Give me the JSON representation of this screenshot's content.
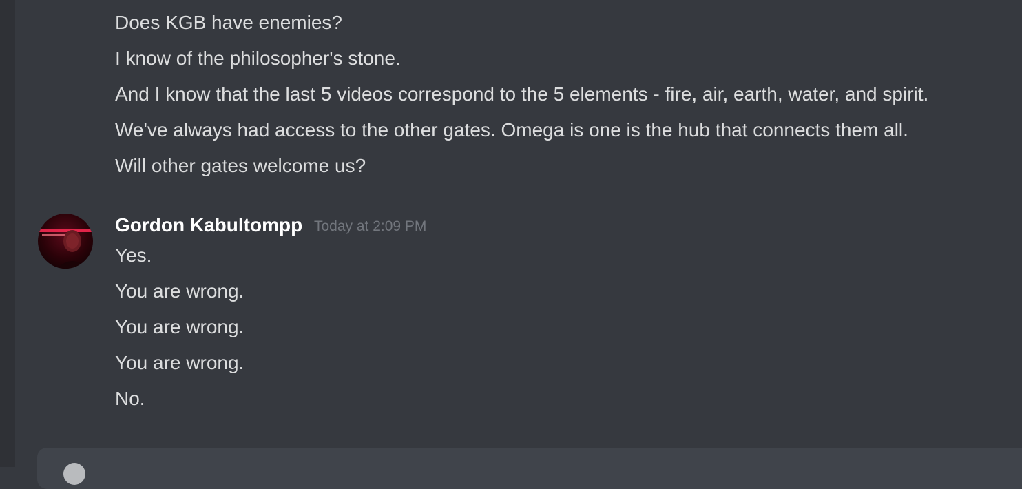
{
  "messages_prev": {
    "lines": [
      "Does KGB have enemies?",
      "I know of the philosopher's stone.",
      "And I know that the last 5 videos correspond to the 5 elements - fire, air, earth, water, and spirit.",
      "We've always had access to the other gates. Omega is one is the hub that connects them all.",
      "Will other gates welcome us?"
    ]
  },
  "message_group": {
    "author": "Gordon Kabultompp",
    "timestamp": "Today at 2:09 PM",
    "lines": [
      "Yes.",
      "You are wrong.",
      "You are wrong.",
      "You are wrong.",
      "No."
    ]
  },
  "composer": {
    "icon": "add-circle-icon"
  },
  "colors": {
    "background": "#36393f",
    "text": "#dcddde",
    "author": "#ffffff",
    "timestamp": "#72767d"
  }
}
